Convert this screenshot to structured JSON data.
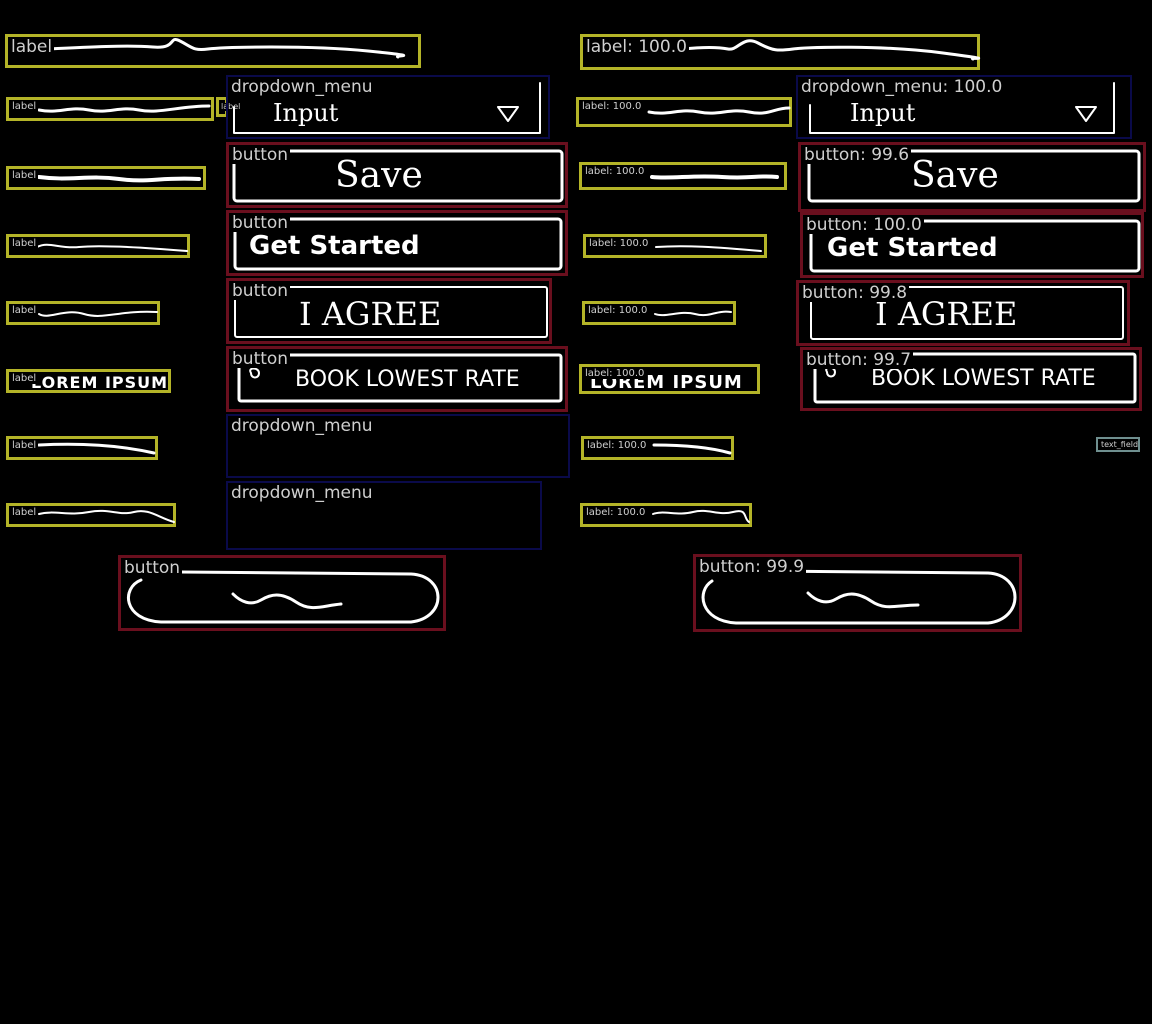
{
  "colors": {
    "background": "#000000",
    "label": "#b4b428",
    "dropdown_menu": "#0a0a4a",
    "button": "#6a0f1e",
    "text_field": "#6f8f8f",
    "sketch": "#ffffff"
  },
  "left": {
    "labels": [
      "label",
      "label",
      "label",
      "label",
      "label",
      "label",
      "label",
      "label"
    ],
    "tiny_label": "label",
    "dropdowns": [
      "dropdown_menu",
      "dropdown_menu",
      "dropdown_menu"
    ],
    "buttons": [
      "button",
      "button",
      "button",
      "button",
      "button"
    ]
  },
  "right": {
    "labels": [
      "label: 100.0",
      "label: 100.0",
      "label: 100.0",
      "label: 100.0",
      "label: 100.0",
      "label: 100.0",
      "label: 100.0",
      "label: 100.0"
    ],
    "dropdowns": [
      "dropdown_menu: 100.0"
    ],
    "buttons": [
      "button: 99.6",
      "button: 100.0",
      "button: 99.8",
      "button: 99.7",
      "button: 99.9"
    ],
    "text_field": "text_field: 3"
  },
  "sketch_text": {
    "input": "Input",
    "save": "Save",
    "get_started": "Get Started",
    "i_agree": "I AGREE",
    "book": "BOOK LOWEST RATE",
    "lorem": "LOREM IPSUM"
  }
}
